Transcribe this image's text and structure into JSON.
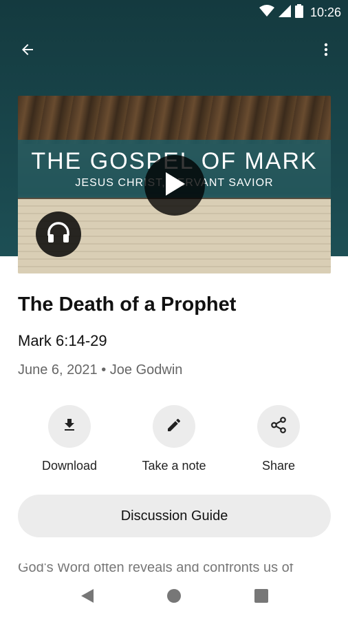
{
  "status_bar": {
    "time": "10:26"
  },
  "toolbar": {
    "back_icon": "arrow-left-icon",
    "more_icon": "more-vertical-icon"
  },
  "artwork": {
    "title": "THE GOSPEL OF MARK",
    "subtitle": "JESUS CHRIST, SERVANT SAVIOR",
    "play_icon": "play-icon",
    "audio_icon": "headphones-icon"
  },
  "sermon": {
    "title": "The Death of a Prophet",
    "scripture": "Mark 6:14-29",
    "date": "June 6, 2021",
    "separator": "•",
    "speaker": "Joe Godwin"
  },
  "actions": [
    {
      "label": "Download",
      "icon": "download-icon"
    },
    {
      "label": "Take a note",
      "icon": "pencil-icon"
    },
    {
      "label": "Share",
      "icon": "share-icon"
    }
  ],
  "discussion_guide": {
    "label": "Discussion Guide"
  },
  "description_preview": "God's Word often reveals and confronts us of",
  "nav_bar": {
    "back_icon": "nav-back-icon",
    "home_icon": "nav-home-icon",
    "recents_icon": "nav-recents-icon"
  },
  "colors": {
    "header": "#1d4f55",
    "button_bg": "#ececec",
    "text_primary": "#111111",
    "text_secondary": "#666666"
  }
}
